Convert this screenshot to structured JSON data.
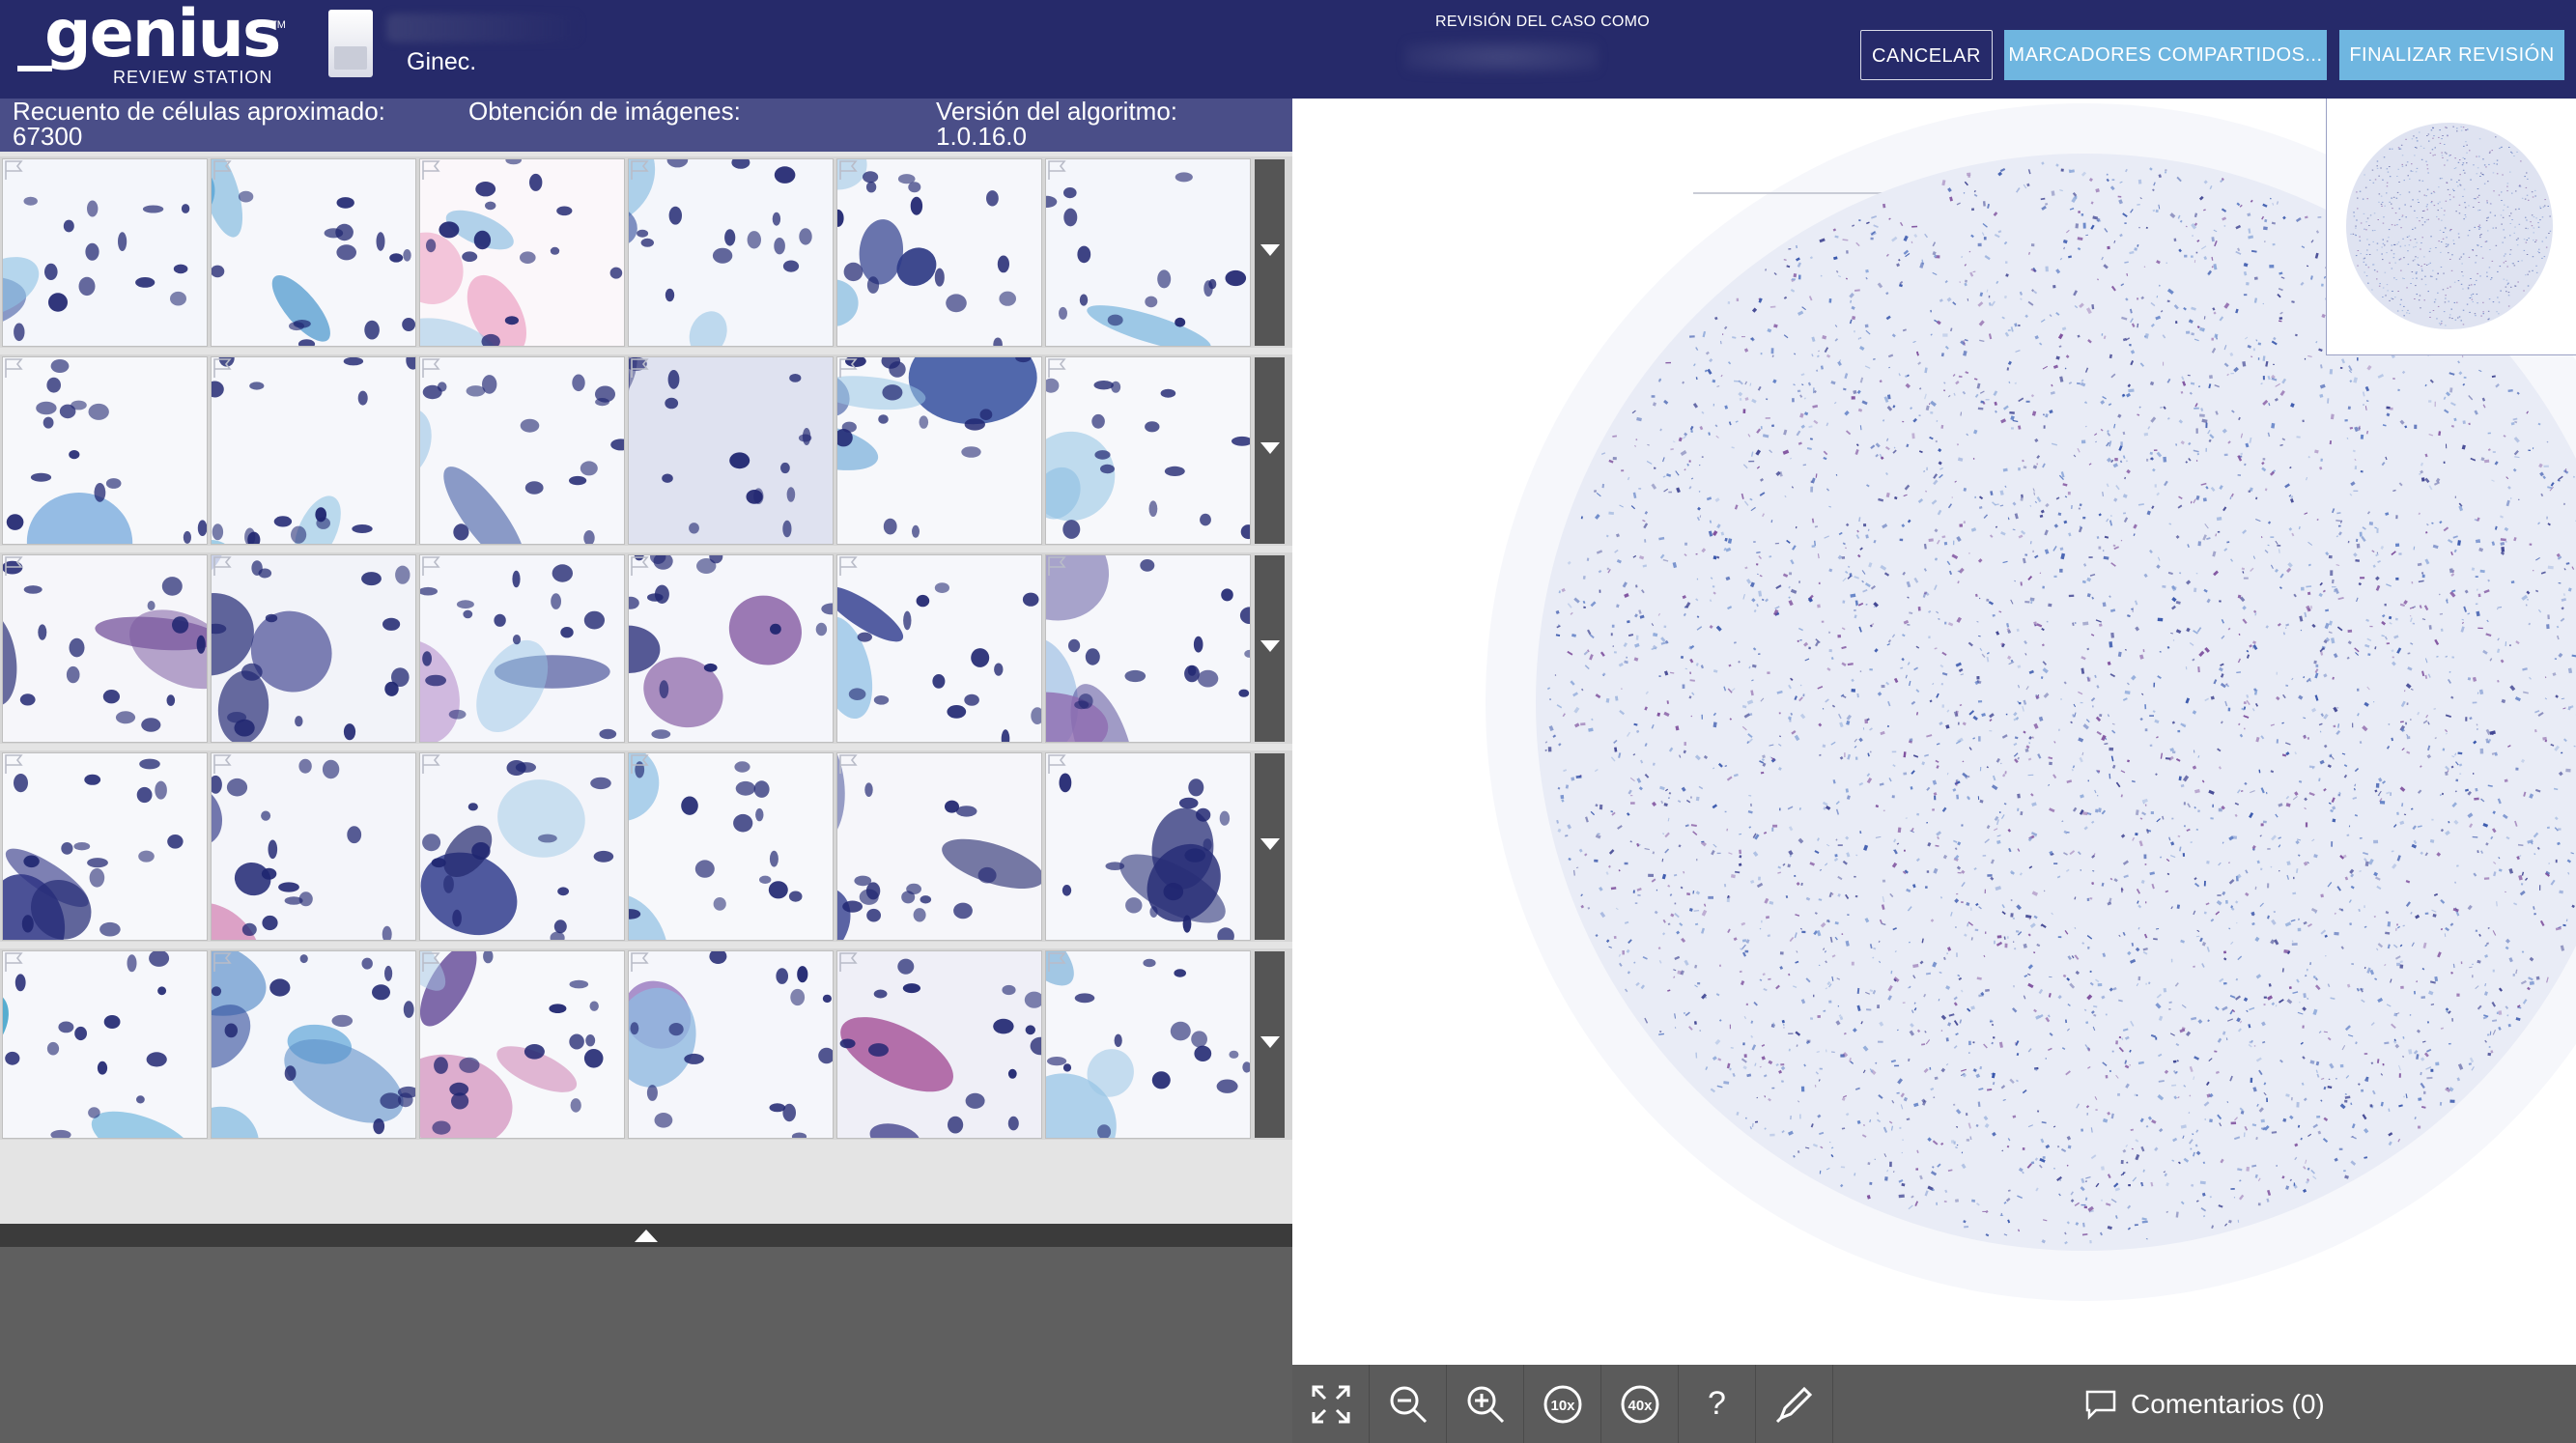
{
  "header": {
    "logo_text": "genius",
    "logo_trademark": "TM",
    "logo_subtitle": "REVIEW STATION",
    "case_type": "Ginec.",
    "review_label": "REVISIÓN DEL CASO COMO",
    "buttons": {
      "cancel": "CANCELAR",
      "shared_markers": "MARCADORES COMPARTIDOS...",
      "finish_review": "FINALIZAR REVISIÓN"
    },
    "colors": {
      "bar": "#262a6a",
      "accent_button": "#6fb6e0"
    }
  },
  "info_bar": {
    "cell_count_label": "Recuento de células aproximado:",
    "cell_count_value": "67300",
    "imaging_label": "Obtención de imágenes:",
    "imaging_value": "",
    "algorithm_label": "Versión del algoritmo:",
    "algorithm_value": "1.0.16.0"
  },
  "gallery": {
    "rows": [
      {
        "tiles": [
          {
            "bg": "#f4f6fb",
            "cells": [
              {
                "c": "#8cc1e3"
              },
              {
                "c": "#5b8fc9"
              },
              {
                "c": "#2f4b9b"
              }
            ]
          },
          {
            "bg": "#f6f7fb",
            "cells": [
              {
                "c": "#5aa6d6"
              },
              {
                "c": "#3f8fc9"
              },
              {
                "c": "#2a3f8c"
              }
            ]
          },
          {
            "bg": "#fbf7fa",
            "cells": [
              {
                "c": "#ea8ab4"
              },
              {
                "c": "#e46ea2"
              },
              {
                "c": "#9cc7e6"
              }
            ]
          },
          {
            "bg": "#f4f6fb",
            "cells": [
              {
                "c": "#9ac6e6"
              },
              {
                "c": "#86b7df"
              },
              {
                "c": "#2f4b9b"
              }
            ]
          },
          {
            "bg": "#f6f7fb",
            "cells": [
              {
                "c": "#8fc0e2"
              },
              {
                "c": "#2e3c8c"
              },
              {
                "c": "#2a3582"
              }
            ]
          },
          {
            "bg": "#f4f6fb",
            "cells": [
              {
                "c": "#7fb7df"
              },
              {
                "c": "#6aa6d6"
              },
              {
                "c": "#2f4b9b"
              }
            ]
          }
        ]
      },
      {
        "tiles": [
          {
            "bg": "#f7f8fb",
            "cells": [
              {
                "c": "#3b4fa0"
              },
              {
                "c": "#2e3c8c"
              },
              {
                "c": "#7faede"
              }
            ]
          },
          {
            "bg": "#f6f7fb",
            "cells": [
              {
                "c": "#8cc1e3"
              },
              {
                "c": "#3a9ccf"
              },
              {
                "c": "#2f4b9b"
              }
            ]
          },
          {
            "bg": "#f6f7fb",
            "cells": [
              {
                "c": "#9ac6e6"
              },
              {
                "c": "#86b7df"
              },
              {
                "c": "#2f4b9b"
              }
            ]
          },
          {
            "bg": "#dfe2f0",
            "cells": [
              {
                "c": "#2a2f7a"
              },
              {
                "c": "#3a3f8e"
              },
              {
                "c": "#23286e"
              }
            ]
          },
          {
            "bg": "#f7f8fb",
            "cells": [
              {
                "c": "#9ac6e6"
              },
              {
                "c": "#86b7df"
              },
              {
                "c": "#2f4b9b"
              }
            ]
          },
          {
            "bg": "#f7f8fb",
            "cells": [
              {
                "c": "#a3cbe8"
              },
              {
                "c": "#8cbfe2"
              },
              {
                "c": "#3a5aa8"
              }
            ]
          }
        ]
      },
      {
        "tiles": [
          {
            "bg": "#f6f6fa",
            "cells": [
              {
                "c": "#232a72"
              },
              {
                "c": "#2d3380"
              },
              {
                "c": "#7b5aa0"
              }
            ]
          },
          {
            "bg": "#f2f3f9",
            "cells": [
              {
                "c": "#262c76"
              },
              {
                "c": "#3a3f8e"
              },
              {
                "c": "#9aa9d6"
              }
            ]
          },
          {
            "bg": "#f5f6fb",
            "cells": [
              {
                "c": "#2e3a8c"
              },
              {
                "c": "#9ac6e6"
              },
              {
                "c": "#c4a6d6"
              }
            ]
          },
          {
            "bg": "#f5f6fb",
            "cells": [
              {
                "c": "#2a2f7a"
              },
              {
                "c": "#8c64a8"
              },
              {
                "c": "#a8c8e6"
              }
            ]
          },
          {
            "bg": "#f6f7fb",
            "cells": [
              {
                "c": "#2e3a8c"
              },
              {
                "c": "#9ac6e6"
              },
              {
                "c": "#3a4fa0"
              }
            ]
          },
          {
            "bg": "#f6f7fb",
            "cells": [
              {
                "c": "#4a3f92"
              },
              {
                "c": "#8e6bb0"
              },
              {
                "c": "#b3cde8"
              }
            ]
          }
        ]
      },
      {
        "tiles": [
          {
            "bg": "#f7f8fb",
            "cells": [
              {
                "c": "#262c76"
              },
              {
                "c": "#2f3585"
              },
              {
                "c": "#343b8c"
              }
            ]
          },
          {
            "bg": "#f4f5fa",
            "cells": [
              {
                "c": "#262c76"
              },
              {
                "c": "#2f3585"
              },
              {
                "c": "#c44a90"
              }
            ]
          },
          {
            "bg": "#f4f5fa",
            "cells": [
              {
                "c": "#22286e"
              },
              {
                "c": "#9ac6e6"
              },
              {
                "c": "#2e3a8c"
              }
            ]
          },
          {
            "bg": "#f7f8fb",
            "cells": [
              {
                "c": "#7fb7df"
              },
              {
                "c": "#3a4fa0"
              },
              {
                "c": "#9ac6e6"
              }
            ]
          },
          {
            "bg": "#f6f6fa",
            "cells": [
              {
                "c": "#22286e"
              },
              {
                "c": "#b04a90"
              },
              {
                "c": "#2e3a8c"
              }
            ]
          },
          {
            "bg": "#f6f7fb",
            "cells": [
              {
                "c": "#262c76"
              },
              {
                "c": "#2f3585"
              },
              {
                "c": "#9ac6e6"
              }
            ]
          }
        ]
      },
      {
        "tiles": [
          {
            "bg": "#f6f7fb",
            "cells": [
              {
                "c": "#3aa0c8"
              },
              {
                "c": "#6ab3dc"
              },
              {
                "c": "#e58ab0"
              }
            ]
          },
          {
            "bg": "#f4f6fb",
            "cells": [
              {
                "c": "#7fb7df"
              },
              {
                "c": "#5b8fc9"
              },
              {
                "c": "#2f4b9b"
              }
            ]
          },
          {
            "bg": "#f7f8fb",
            "cells": [
              {
                "c": "#d8a0c6"
              },
              {
                "c": "#5b3f92"
              },
              {
                "c": "#a8c8e6"
              }
            ]
          },
          {
            "bg": "#f5f6fb",
            "cells": [
              {
                "c": "#9a7cc0"
              },
              {
                "c": "#8fb9e0"
              },
              {
                "c": "#3a3f8e"
              }
            ]
          },
          {
            "bg": "#efeff7",
            "cells": [
              {
                "c": "#2e2f80"
              },
              {
                "c": "#9a3a8a"
              },
              {
                "c": "#3a4fa0"
              }
            ]
          },
          {
            "bg": "#f6f7fb",
            "cells": [
              {
                "c": "#6aa6d6"
              },
              {
                "c": "#2f4b9b"
              },
              {
                "c": "#9ac6e6"
              }
            ]
          }
        ]
      }
    ]
  },
  "toolbar": {
    "tools": [
      {
        "name": "fit-screen-icon",
        "label": ""
      },
      {
        "name": "zoom-out-icon",
        "label": ""
      },
      {
        "name": "zoom-in-icon",
        "label": ""
      },
      {
        "name": "zoom-10x-icon",
        "label": "10x"
      },
      {
        "name": "zoom-40x-icon",
        "label": "40x"
      },
      {
        "name": "help-icon",
        "label": "?"
      },
      {
        "name": "pen-icon",
        "label": ""
      }
    ],
    "comments_label": "Comentarios (0)"
  },
  "slide": {
    "stain_colors": [
      "#2f4fa8",
      "#5b7cc4",
      "#8aa6d8",
      "#3a3f8e",
      "#7a4a9a"
    ]
  }
}
